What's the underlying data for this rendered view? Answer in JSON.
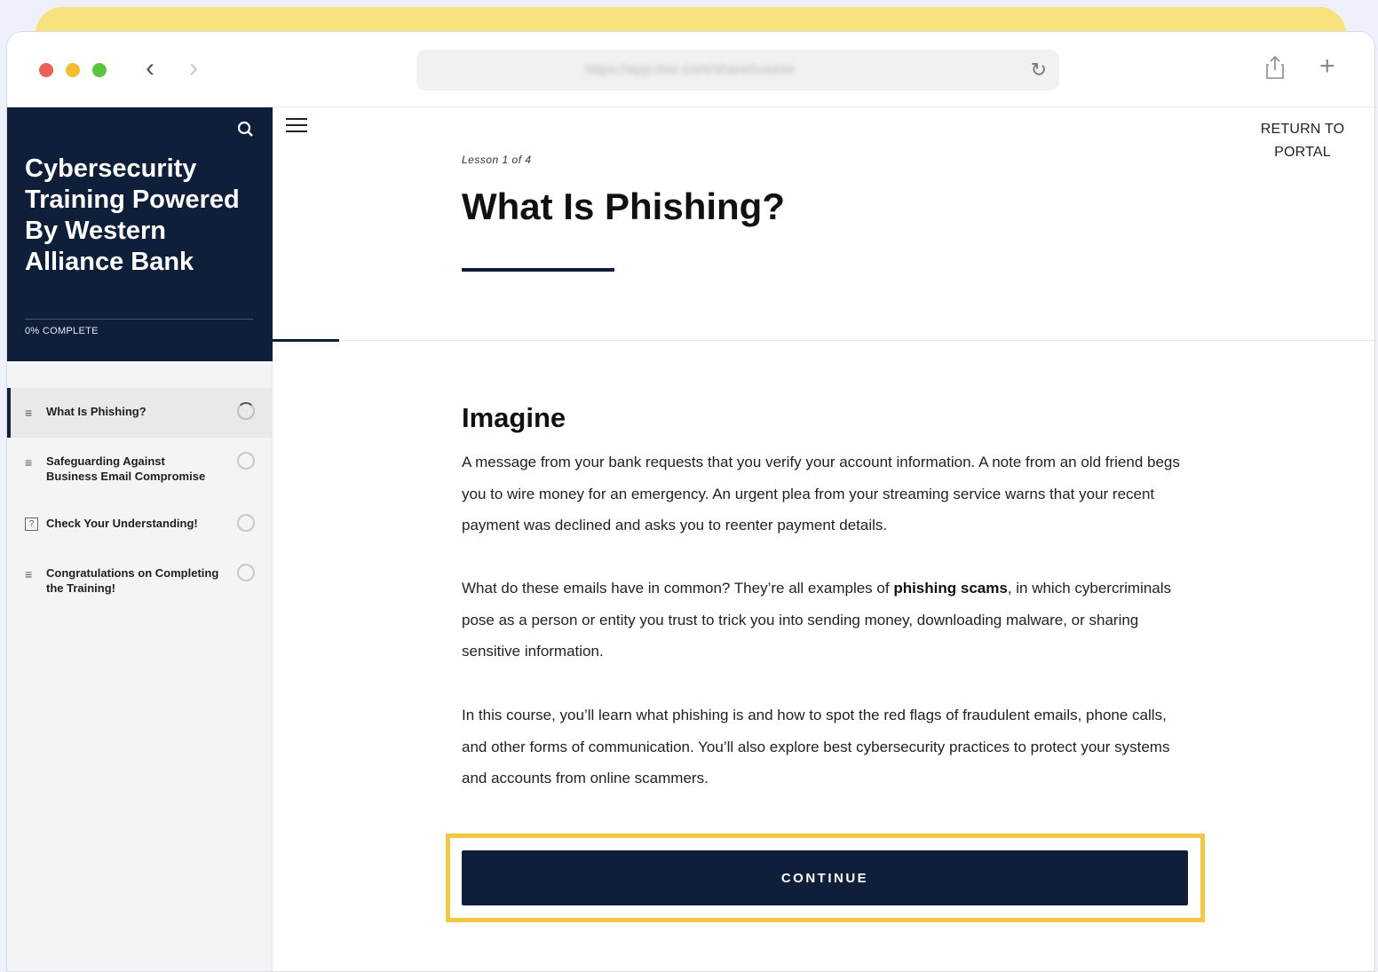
{
  "browser": {
    "address": "https://app.rise.com/share/course",
    "icons": [
      "back-icon",
      "forward-icon",
      "reload-icon",
      "share-icon",
      "new-tab-icon"
    ]
  },
  "sidebar": {
    "course_title": "Cybersecurity Training Powered By Western Alliance Bank",
    "progress_label": "0% COMPLETE",
    "lessons": [
      {
        "label": "What Is Phishing?",
        "icon": "text-lines-icon",
        "active": true
      },
      {
        "label": "Safeguarding Against Business Email Compromise",
        "icon": "text-lines-icon",
        "active": false
      },
      {
        "label": "Check Your Understanding!",
        "icon": "quiz-icon",
        "active": false
      },
      {
        "label": "Congratulations on Completing the Training!",
        "icon": "text-lines-icon",
        "active": false
      }
    ]
  },
  "main": {
    "return_label": "RETURN TO PORTAL",
    "lesson_counter": "Lesson 1 of 4",
    "lesson_title": "What Is Phishing?",
    "section_heading": "Imagine",
    "paragraph1": "A message from your bank requests that you verify your account information. A note from an old friend begs you to wire money for an emergency. An urgent plea from your streaming service warns that your recent payment was declined and asks you to reenter payment details.",
    "paragraph2_before": "What do these emails have in common? They’re all examples of ",
    "paragraph2_bold": "phishing scams",
    "paragraph2_after": ", in which cybercriminals pose as a person or entity you trust to trick you into sending money, downloading malware, or sharing sensitive information.",
    "paragraph3": "In this course, you’ll learn what phishing is and how to spot the red flags of fraudulent emails, phone calls, and other forms of communication. You’ll also explore best cybersecurity practices to protect your systems and accounts from online scammers.",
    "continue_label": "CONTINUE"
  },
  "colors": {
    "navy": "#0f1f3a",
    "highlight": "#f2c744",
    "banner": "#f7e17c"
  }
}
